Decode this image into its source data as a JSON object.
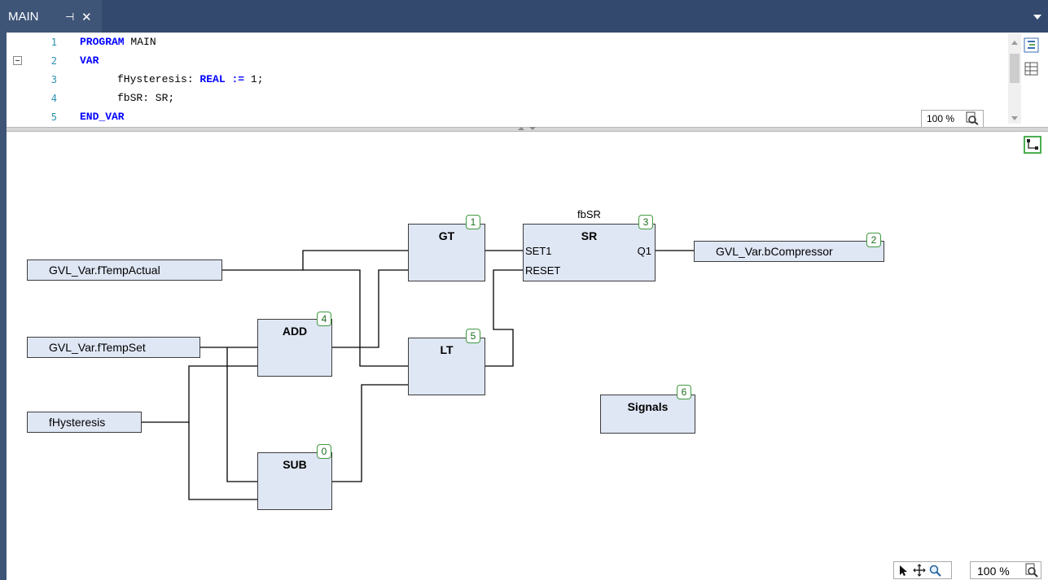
{
  "tab": {
    "title": "MAIN",
    "pin_glyph": "⊣",
    "close_glyph": "✕"
  },
  "declaration": {
    "lines": [
      {
        "number": "1",
        "text": "PROGRAM MAIN"
      },
      {
        "number": "2",
        "text": "VAR"
      },
      {
        "number": "3",
        "text": "fHysteresis: REAL := 1;"
      },
      {
        "number": "4",
        "text": "fbSR: SR;"
      },
      {
        "number": "5",
        "text": "END_VAR"
      }
    ],
    "zoom": "100 %"
  },
  "fbd": {
    "variables": {
      "temp_actual": "GVL_Var.fTempActual",
      "temp_set": "GVL_Var.fTempSet",
      "hysteresis": "fHysteresis",
      "compressor": "GVL_Var.bCompressor"
    },
    "blocks": {
      "gt": {
        "name": "GT",
        "order": "1"
      },
      "sr": {
        "name": "SR",
        "order": "3",
        "instance": "fbSR",
        "inputs": [
          "SET1",
          "RESET"
        ],
        "output": "Q1"
      },
      "add": {
        "name": "ADD",
        "order": "4"
      },
      "lt": {
        "name": "LT",
        "order": "5"
      },
      "sub": {
        "name": "SUB",
        "order": "0"
      },
      "signals": {
        "name": "Signals",
        "order": "6"
      }
    },
    "output_order": "2",
    "zoom": "100 %"
  },
  "icons": [
    "pin-icon",
    "close-icon",
    "dropdown-icon",
    "outline-icon",
    "table-view-icon",
    "zoom-lens-icon",
    "fbd-toolbox-icon",
    "pointer-icon",
    "pan-icon",
    "magnifier-icon"
  ],
  "colors": {
    "tab_background": "#3f5578",
    "block_fill": "#dfe6f4",
    "keyword": "#0000ff",
    "line_number": "#2b91af",
    "badge_border": "#3f9a3f"
  }
}
